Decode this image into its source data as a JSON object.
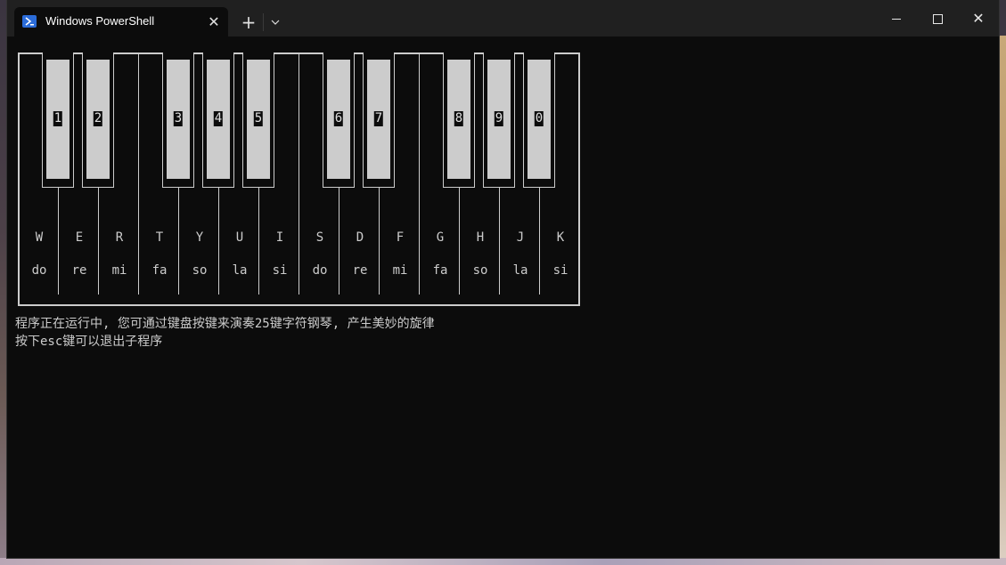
{
  "window": {
    "tab_title": "Windows PowerShell",
    "tab_close_glyph": "✕",
    "new_tab_glyph": "+",
    "dropdown_glyph": "⌄",
    "close_glyph": "✕"
  },
  "piano": {
    "black_keys": [
      "1",
      "2",
      "3",
      "4",
      "5",
      "6",
      "7",
      "8",
      "9",
      "0"
    ],
    "white_keys": [
      {
        "letter": "W",
        "note": "do"
      },
      {
        "letter": "E",
        "note": "re"
      },
      {
        "letter": "R",
        "note": "mi"
      },
      {
        "letter": "T",
        "note": "fa"
      },
      {
        "letter": "Y",
        "note": "so"
      },
      {
        "letter": "U",
        "note": "la"
      },
      {
        "letter": "I",
        "note": "si"
      },
      {
        "letter": "S",
        "note": "do"
      },
      {
        "letter": "D",
        "note": "re"
      },
      {
        "letter": "F",
        "note": "mi"
      },
      {
        "letter": "G",
        "note": "fa"
      },
      {
        "letter": "H",
        "note": "so"
      },
      {
        "letter": "J",
        "note": "la"
      },
      {
        "letter": "K",
        "note": "si"
      }
    ]
  },
  "messages": {
    "line1": "程序正在运行中, 您可通过键盘按键来演奏25键字符钢琴, 产生美妙的旋律",
    "line2": "按下esc键可以退出子程序"
  },
  "colors": {
    "terminal_bg": "#0c0c0c",
    "terminal_fg": "#cccccc",
    "titlebar_bg": "#202020",
    "ps_icon": "#2b6cd9"
  }
}
